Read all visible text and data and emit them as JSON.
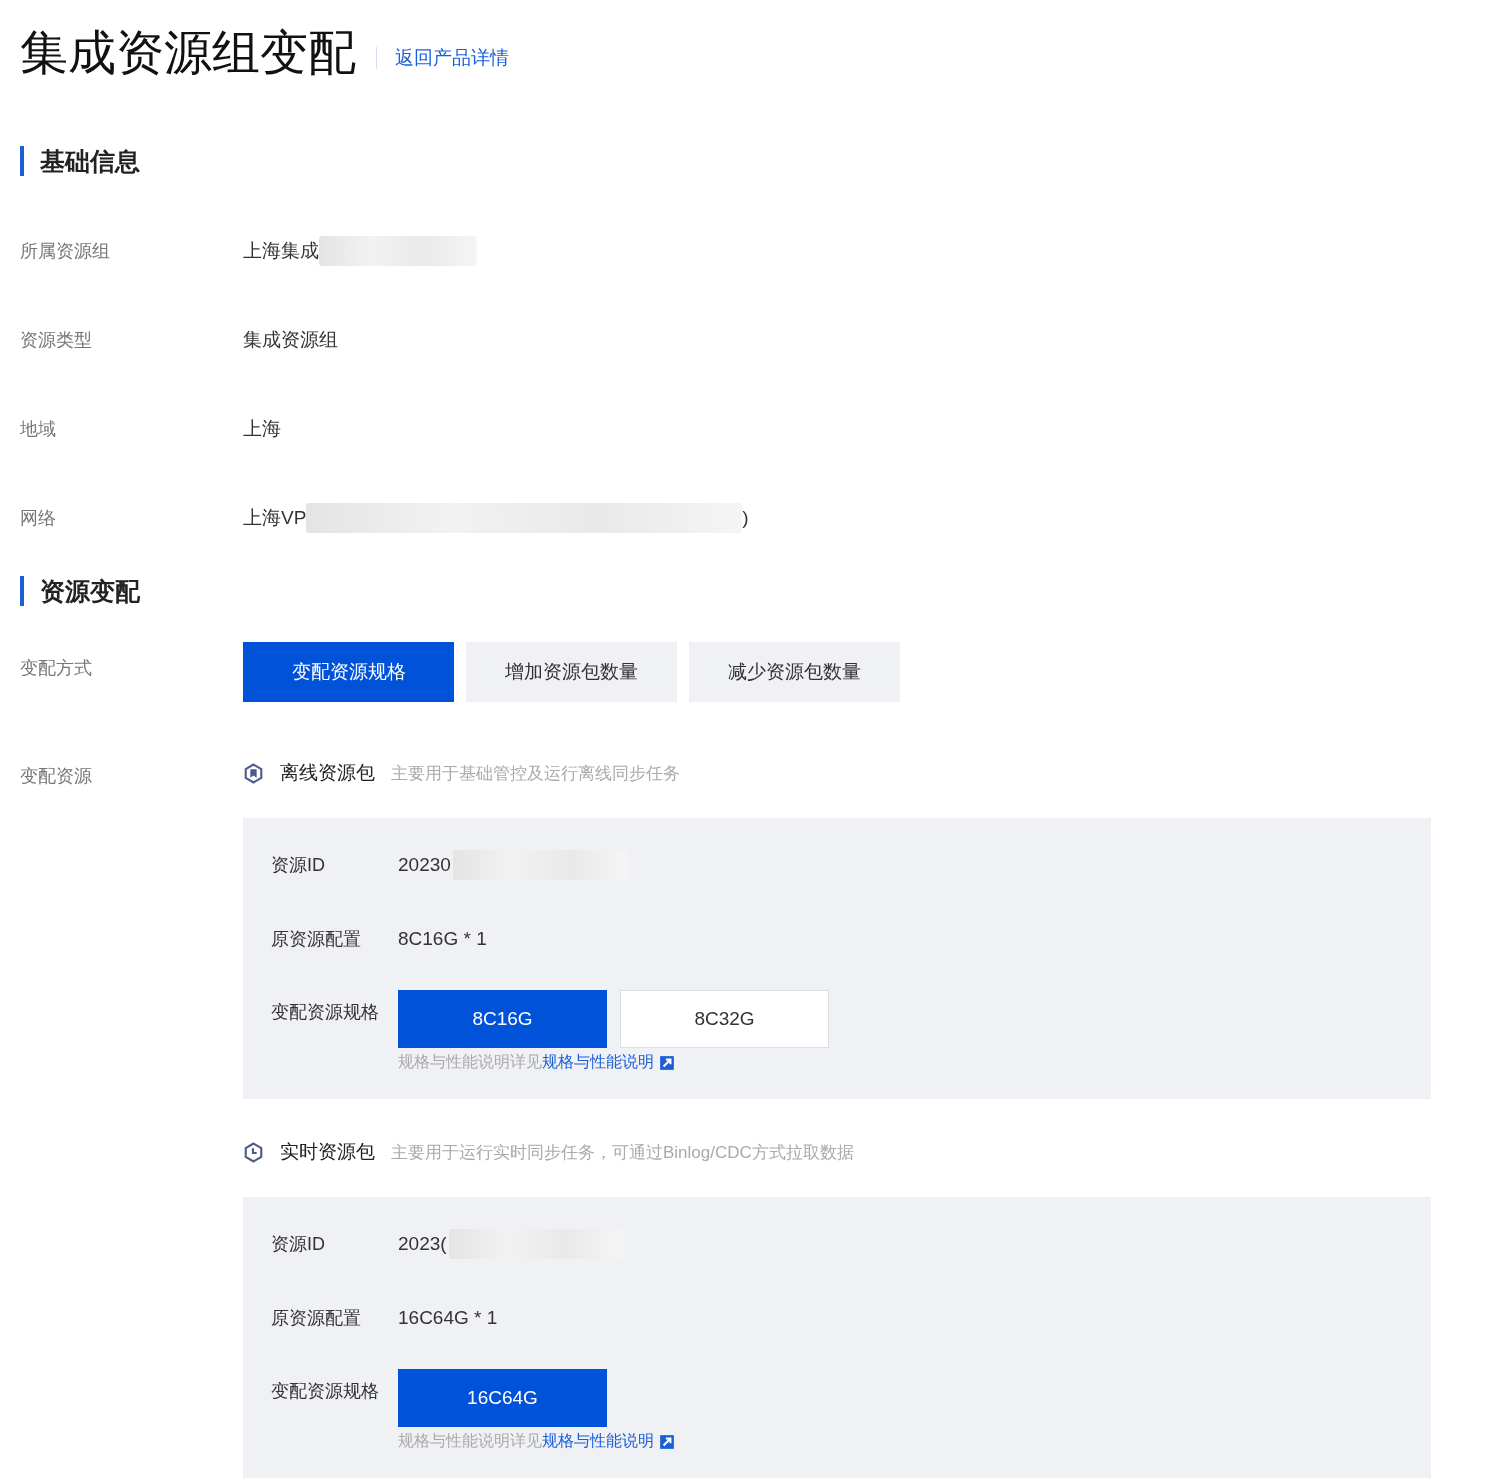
{
  "page": {
    "title": "集成资源组变配",
    "back_link": "返回产品详情"
  },
  "basic_info": {
    "heading": "基础信息",
    "fields": [
      {
        "label": "所属资源组",
        "value": "上海集成",
        "redacted": true
      },
      {
        "label": "资源类型",
        "value": "集成资源组",
        "redacted": false
      },
      {
        "label": "地域",
        "value": "上海",
        "redacted": false
      },
      {
        "label": "网络",
        "value": "上海VP",
        "redacted": true,
        "suffix": ")"
      }
    ]
  },
  "resource_change": {
    "heading": "资源变配",
    "mode_label": "变配方式",
    "modes": [
      {
        "label": "变配资源规格",
        "selected": true
      },
      {
        "label": "增加资源包数量",
        "selected": false
      },
      {
        "label": "减少资源包数量",
        "selected": false
      }
    ],
    "resource_label": "变配资源",
    "packages": [
      {
        "kind": "offline",
        "name": "离线资源包",
        "description": "主要用于基础管控及运行离线同步任务",
        "id_label": "资源ID",
        "id_value": "20230",
        "id_redacted": true,
        "orig_label": "原资源配置",
        "orig_value": "8C16G * 1",
        "spec_label": "变配资源规格",
        "specs": [
          {
            "label": "8C16G",
            "selected": true
          },
          {
            "label": "8C32G",
            "selected": false
          }
        ],
        "hint": "规格与性能说明详见",
        "hint_link": "规格与性能说明"
      },
      {
        "kind": "realtime",
        "name": "实时资源包",
        "description": "主要用于运行实时同步任务，可通过Binlog/CDC方式拉取数据",
        "id_label": "资源ID",
        "id_value": "2023(",
        "id_redacted": true,
        "orig_label": "原资源配置",
        "orig_value": "16C64G * 1",
        "spec_label": "变配资源规格",
        "specs": [
          {
            "label": "16C64G",
            "selected": true
          }
        ],
        "hint": "规格与性能说明详见",
        "hint_link": "规格与性能说明"
      }
    ]
  }
}
